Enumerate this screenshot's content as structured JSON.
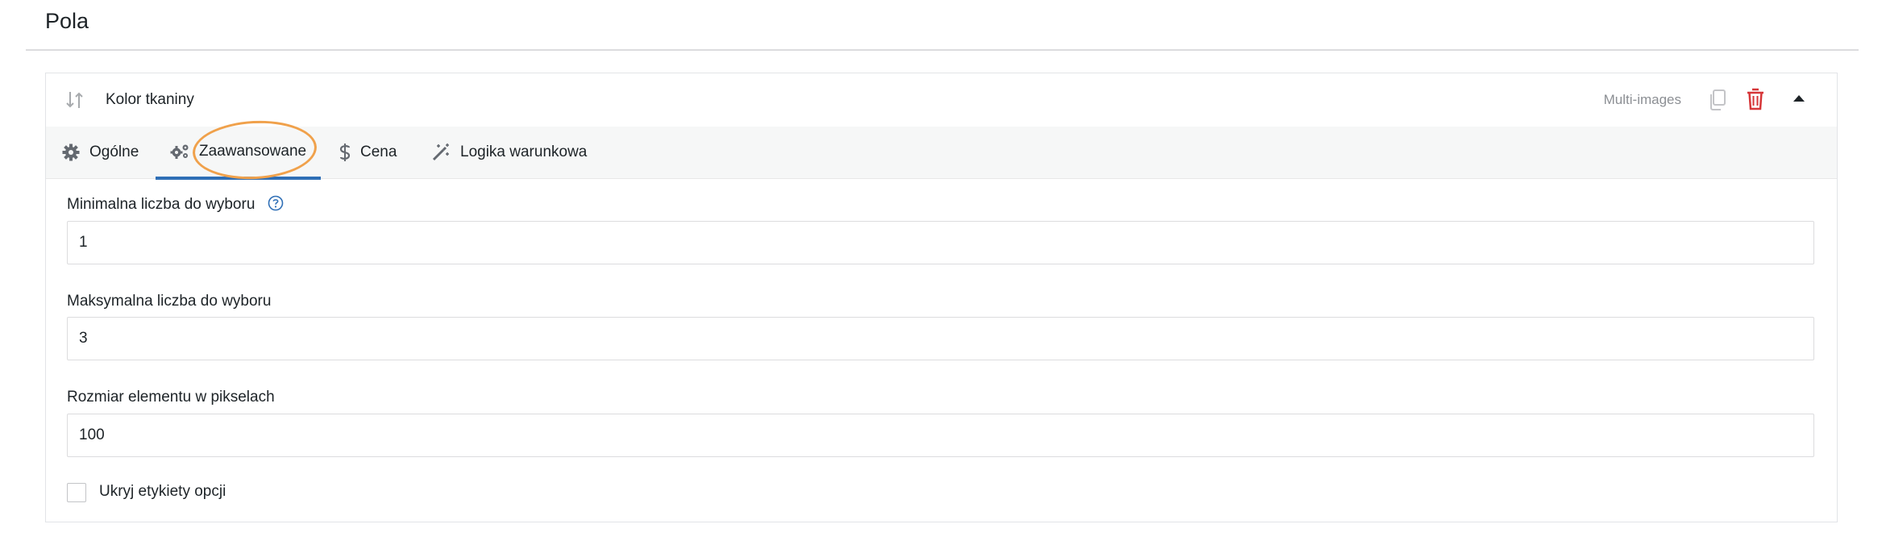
{
  "section": {
    "title": "Pola"
  },
  "field": {
    "name": "Kolor tkaniny",
    "type": "Multi-images",
    "icons": [
      "sort-icon",
      "copy-icon",
      "trash-icon",
      "caret-up-icon"
    ]
  },
  "tabs": [
    {
      "label": "Ogólne",
      "icon": "gear-icon",
      "active": false
    },
    {
      "label": "Zaawansowane",
      "icon": "gears-icon",
      "active": true
    },
    {
      "label": "Cena",
      "icon": "dollar-icon",
      "active": false
    },
    {
      "label": "Logika warunkowa",
      "icon": "magic-wand-icon",
      "active": false
    }
  ],
  "form": {
    "min_label": "Minimalna liczba do wyboru",
    "min_value": "1",
    "max_label": "Maksymalna liczba do wyboru",
    "max_value": "3",
    "size_label": "Rozmiar elementu w pikselach",
    "size_value": "100",
    "hide_labels_label": "Ukryj etykiety opcji",
    "hide_labels_checked": false
  },
  "colors": {
    "accent": "#2f6fb6",
    "delete": "#d63638",
    "highlight": "#f0a14b",
    "muted": "#8c8f94"
  }
}
